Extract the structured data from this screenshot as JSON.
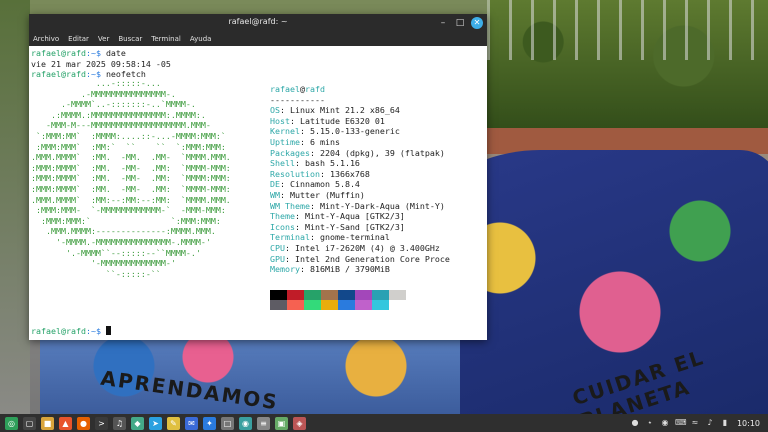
{
  "window": {
    "title": "rafael@rafd: ~",
    "menu": [
      "Archivo",
      "Editar",
      "Ver",
      "Buscar",
      "Terminal",
      "Ayuda"
    ]
  },
  "terminal": {
    "prompt_user": "rafael@rafd",
    "prompt_path": ":~$ ",
    "cmd1": "date",
    "out1": "vie 21 mar 2025 09:58:14 -05",
    "cmd2": "neofetch",
    "logo_lines": [
      "             ...-:::::-...",
      "          .-MMMMMMMMMMMMMMM-.",
      "      .-MMMM`..-:::::::-..`MMMM-.",
      "    .:MMMM.:MMMMMMMMMMMMMMM:.MMMM:.",
      "   -MMM-M---MMMMMMMMMMMMMMMMMMM.MMM-",
      " `:MMM:MM`  :MMMM:....::-...-MMMM:MMM:`",
      " :MMM:MMM`  :MM:`  ``    ``  `:MMM:MMM:",
      ".MMM.MMMM`  :MM.  -MM.  .MM-  `MMMM.MMM.",
      ":MMM:MMMM`  :MM.  -MM-  .MM:  `MMMM-MMM:",
      ":MMM:MMMM`  :MM.  -MM-  .MM:  `MMMM:MMM:",
      ":MMM:MMMM`  :MM.  -MM-  .MM:  `MMMM-MMM:",
      ".MMM.MMMM`  :MM:--:MM:--:MM:  `MMMM.MMM.",
      " :MMM:MMM-  `-MMMMMMMMMMMM-`  -MMM-MMM:",
      "  :MMM:MMM:`                `:MMM:MMM:",
      "   .MMM.MMMM:--------------:MMMM.MMM.",
      "     '-MMMM.-MMMMMMMMMMMMMMM-.MMMM-'",
      "       '.-MMMM``--:::::--``MMMM-.'",
      "            '-MMMMMMMMMMMMM-'",
      "               ``-:::::-``"
    ],
    "info_header_user": "rafael",
    "info_header_at": "@",
    "info_header_host": "rafd",
    "info_sep": "-----------",
    "info": [
      {
        "k": "OS",
        "v": "Linux Mint 21.2 x86_64"
      },
      {
        "k": "Host",
        "v": "Latitude E6320 01"
      },
      {
        "k": "Kernel",
        "v": "5.15.0-133-generic"
      },
      {
        "k": "Uptime",
        "v": "6 mins"
      },
      {
        "k": "Packages",
        "v": "2204 (dpkg), 39 (flatpak)"
      },
      {
        "k": "Shell",
        "v": "bash 5.1.16"
      },
      {
        "k": "Resolution",
        "v": "1366x768"
      },
      {
        "k": "DE",
        "v": "Cinnamon 5.8.4"
      },
      {
        "k": "WM",
        "v": "Mutter (Muffin)"
      },
      {
        "k": "WM Theme",
        "v": "Mint-Y-Dark-Aqua (Mint-Y)"
      },
      {
        "k": "Theme",
        "v": "Mint-Y-Aqua [GTK2/3]"
      },
      {
        "k": "Icons",
        "v": "Mint-Y-Sand [GTK2/3]"
      },
      {
        "k": "Terminal",
        "v": "gnome-terminal"
      },
      {
        "k": "CPU",
        "v": "Intel i7-2620M (4) @ 3.400GHz"
      },
      {
        "k": "GPU",
        "v": "Intel 2nd Generation Core Proce"
      },
      {
        "k": "Memory",
        "v": "816MiB / 3790MiB"
      }
    ],
    "colon": ": ",
    "palette_row1": [
      "#000000",
      "#c01c28",
      "#26a269",
      "#a2734c",
      "#12488b",
      "#a347ba",
      "#2aa1b3",
      "#d0cfcc"
    ],
    "palette_row2": [
      "#5e5c64",
      "#f66151",
      "#33da7a",
      "#e9ad0c",
      "#2a7bde",
      "#c061cb",
      "#33c7de",
      "#ffffff"
    ]
  },
  "wallpaper": {
    "text_left": "APRENDAMOS",
    "text_right": "CUIDAR EL PLANETA"
  },
  "taskbar": {
    "icons": [
      "mint-menu-icon",
      "show-desktop-icon",
      "files-icon",
      "brave-icon",
      "firefox-icon",
      "terminal-icon",
      "media-icon",
      "app-icon",
      "telegram-icon",
      "notes-icon",
      "mail-icon",
      "vscode-icon",
      "window-icon",
      "camera-icon",
      "text-editor-icon",
      "app2-icon",
      "app3-icon"
    ],
    "clock": "10:10"
  }
}
